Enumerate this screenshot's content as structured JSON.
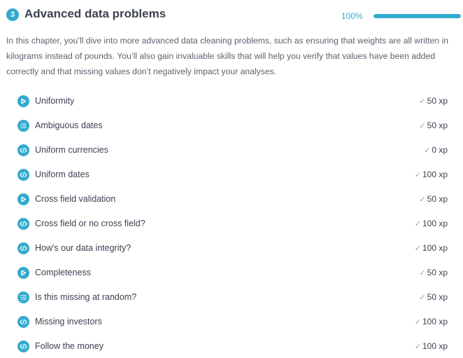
{
  "chapter": {
    "number": "3",
    "title": "Advanced data problems",
    "progress_label": "100%",
    "progress_fraction": 1.0,
    "description": "In this chapter, you’ll dive into more advanced data cleaning problems, such as ensuring that weights are all written in kilograms instead of pounds. You’ll also gain invaluable skills that will help you verify that values have been added correctly and that missing values don’t negatively impact your analyses."
  },
  "check_glyph": "✓",
  "accent_color": "#33aacc",
  "lessons": [
    {
      "title": "Uniformity",
      "xp": "50 xp",
      "icon": "video-play-icon"
    },
    {
      "title": "Ambiguous dates",
      "xp": "50 xp",
      "icon": "multiple-choice-list-icon"
    },
    {
      "title": "Uniform currencies",
      "xp": "0 xp",
      "icon": "code-exercise-icon"
    },
    {
      "title": "Uniform dates",
      "xp": "100 xp",
      "icon": "code-exercise-icon"
    },
    {
      "title": "Cross field validation",
      "xp": "50 xp",
      "icon": "video-play-icon"
    },
    {
      "title": "Cross field or no cross field?",
      "xp": "100 xp",
      "icon": "code-exercise-icon"
    },
    {
      "title": "How's our data integrity?",
      "xp": "100 xp",
      "icon": "code-exercise-icon"
    },
    {
      "title": "Completeness",
      "xp": "50 xp",
      "icon": "video-play-icon"
    },
    {
      "title": "Is this missing at random?",
      "xp": "50 xp",
      "icon": "multiple-choice-list-icon"
    },
    {
      "title": "Missing investors",
      "xp": "100 xp",
      "icon": "code-exercise-icon"
    },
    {
      "title": "Follow the money",
      "xp": "100 xp",
      "icon": "code-exercise-icon"
    }
  ]
}
